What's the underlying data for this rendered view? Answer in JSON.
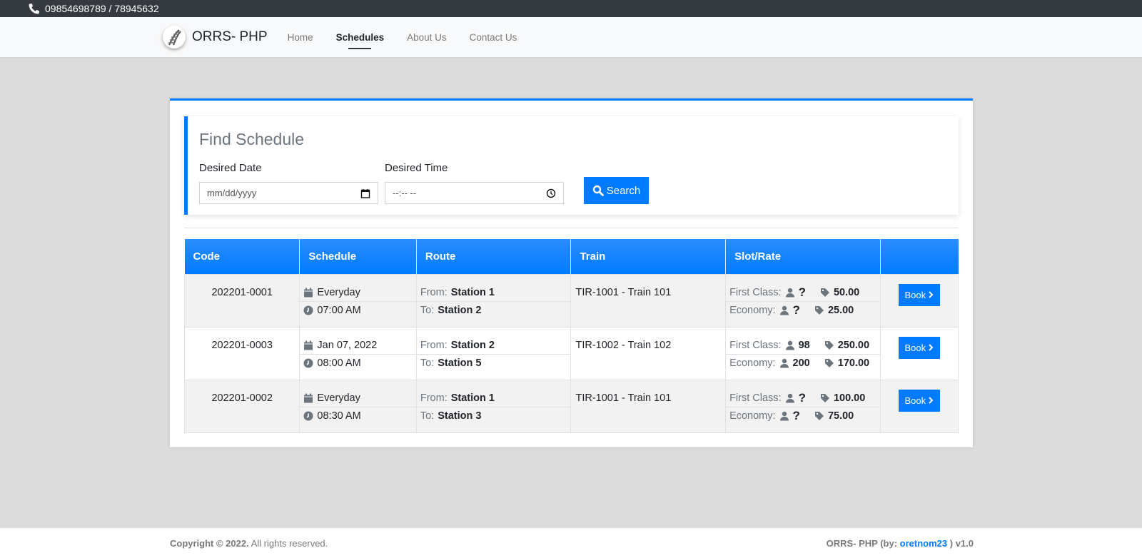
{
  "topbar": {
    "phone": "09854698789 / 78945632"
  },
  "navbar": {
    "brand": "ORRS- PHP",
    "items": [
      {
        "label": "Home",
        "active": false
      },
      {
        "label": "Schedules",
        "active": true
      },
      {
        "label": "About Us",
        "active": false
      },
      {
        "label": "Contact Us",
        "active": false
      }
    ]
  },
  "finder": {
    "title": "Find Schedule",
    "date_label": "Desired Date",
    "date_placeholder": "mm/dd/yyyy",
    "time_label": "Desired Time",
    "time_placeholder": "--:-- --",
    "search_label": "Search"
  },
  "table": {
    "headers": [
      "Code",
      "Schedule",
      "Route",
      "Train",
      "Slot/Rate",
      ""
    ],
    "from_label": "From:",
    "to_label": "To:",
    "first_class_label": "First Class:",
    "economy_label": "Economy:",
    "book_label": "Book",
    "rows": [
      {
        "code": "202201-0001",
        "date": "Everyday",
        "time": "07:00 AM",
        "from": "Station 1",
        "to": "Station 2",
        "train": "TIR-1001 - Train 101",
        "first_slots": "?",
        "first_rate": "50.00",
        "eco_slots": "?",
        "eco_rate": "25.00"
      },
      {
        "code": "202201-0003",
        "date": "Jan 07, 2022",
        "time": "08:00 AM",
        "from": "Station 2",
        "to": "Station 5",
        "train": "TIR-1002 - Train 102",
        "first_slots": "98",
        "first_rate": "250.00",
        "eco_slots": "200",
        "eco_rate": "170.00"
      },
      {
        "code": "202201-0002",
        "date": "Everyday",
        "time": "08:30 AM",
        "from": "Station 1",
        "to": "Station 3",
        "train": "TIR-1001 - Train 101",
        "first_slots": "?",
        "first_rate": "100.00",
        "eco_slots": "?",
        "eco_rate": "75.00"
      }
    ]
  },
  "footer": {
    "copyright": "Copyright © 2022.",
    "rights": " All rights reserved.",
    "credit_prefix": "ORRS- PHP (by: ",
    "author": "oretnom23",
    "credit_suffix": " ) v1.0"
  }
}
